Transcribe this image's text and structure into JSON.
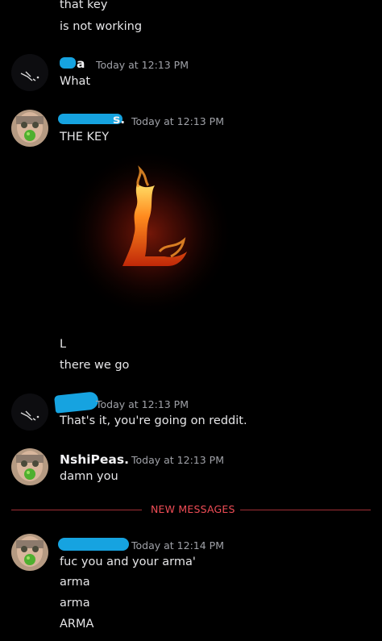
{
  "colors": {
    "background": "#000000",
    "accent_new": "#f04d56",
    "redaction": "#16a3e0",
    "timestamp": "#a0a2a8"
  },
  "messages": {
    "m0": {
      "line1": "that key",
      "line2": "is not working"
    },
    "m1": {
      "author_visible_end": "a",
      "timestamp": "Today at 12:13 PM",
      "text": "What"
    },
    "m2": {
      "author_visible_end": "s.",
      "timestamp": "Today at 12:13 PM",
      "text": "THE  KEY",
      "image_alt_letter": "L",
      "after1": "L",
      "after2": "there we go"
    },
    "m3": {
      "timestamp": "Today at 12:13 PM",
      "text": "That's it, you're going on reddit."
    },
    "m4": {
      "author": "NshiPeas.",
      "timestamp": "Today at 12:13 PM",
      "text": "damn you"
    },
    "divider": {
      "label": "NEW MESSAGES"
    },
    "m5": {
      "timestamp": "Today at 12:14 PM",
      "lines": [
        "fuc you and your arma'",
        "arma",
        "arma",
        "ARMA"
      ]
    }
  },
  "icons": {
    "avatar_dark": "dragon-sketch-avatar",
    "avatar_face": "face-avatar"
  }
}
